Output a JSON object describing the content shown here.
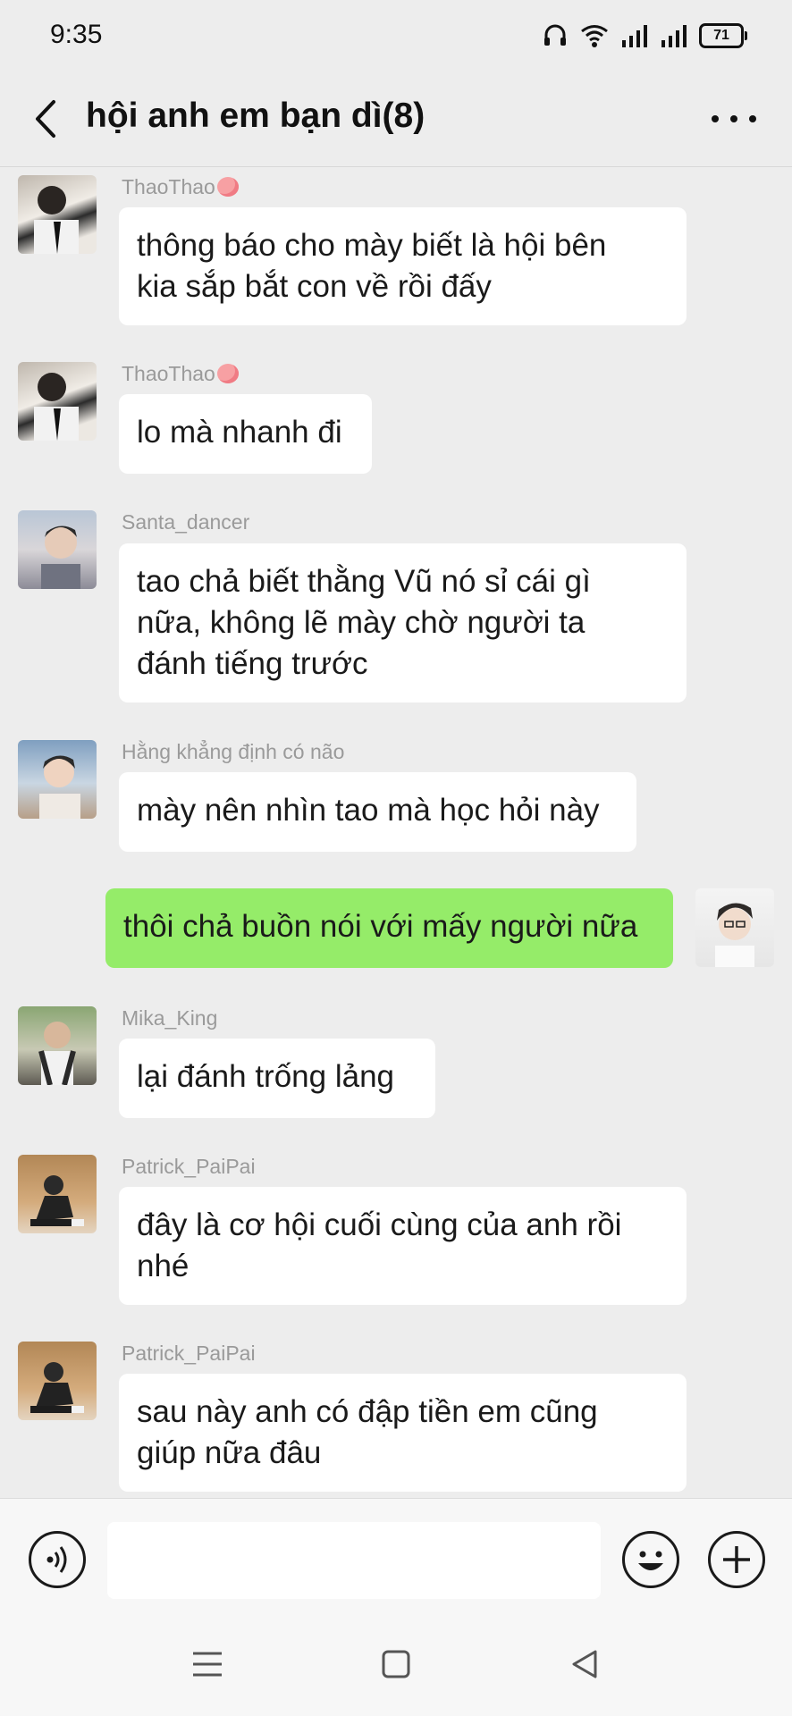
{
  "status_bar": {
    "time": "9:35",
    "battery": "71",
    "icons": [
      "headphones-icon",
      "wifi-icon",
      "signal-icon",
      "signal-icon",
      "battery-icon"
    ]
  },
  "header": {
    "title": "hội anh em bạn dì(8)",
    "back_icon": "chevron-left-icon",
    "more_icon": "more-dots-icon"
  },
  "messages": [
    {
      "sender": "ThaoThao",
      "emoji": "peach",
      "lines": [
        "thông báo cho mày biết là hội bên",
        "kia sắp bắt con về rồi đấy"
      ],
      "outgoing": false
    },
    {
      "sender": "ThaoThao",
      "emoji": "peach",
      "lines": [
        "lo mà nhanh đi"
      ],
      "outgoing": false
    },
    {
      "sender": "Santa_dancer",
      "lines": [
        "tao chả biết thằng Vũ nó sỉ cái gì",
        "nữa, không lẽ mày chờ người ta",
        "đánh tiếng trước"
      ],
      "outgoing": false
    },
    {
      "sender": "Hằng khẳng định có não",
      "lines": [
        "mày nên nhìn tao mà học hỏi này"
      ],
      "outgoing": false
    },
    {
      "sender": "",
      "lines": [
        "thôi chả buồn nói với mấy người nữa"
      ],
      "outgoing": true
    },
    {
      "sender": "Mika_King",
      "lines": [
        "lại đánh trống lảng"
      ],
      "outgoing": false
    },
    {
      "sender": "Patrick_PaiPai",
      "lines": [
        "đây là cơ hội cuối cùng của anh rồi",
        "nhé"
      ],
      "outgoing": false
    },
    {
      "sender": "Patrick_PaiPai",
      "lines": [
        "sau này anh có đập tiền em cũng",
        "giúp nữa đâu"
      ],
      "outgoing": false
    }
  ],
  "input_bar": {
    "voice_icon": "voice-icon",
    "emoji_icon": "emoji-icon",
    "add_icon": "plus-icon",
    "value": ""
  },
  "nav_bar": {
    "icons": [
      "menu-icon",
      "home-icon",
      "back-triangle-icon"
    ]
  },
  "colors": {
    "background": "#ededed",
    "incoming_bubble": "#ffffff",
    "outgoing_bubble": "#95ec69",
    "sender_name": "#9a9a9a"
  }
}
